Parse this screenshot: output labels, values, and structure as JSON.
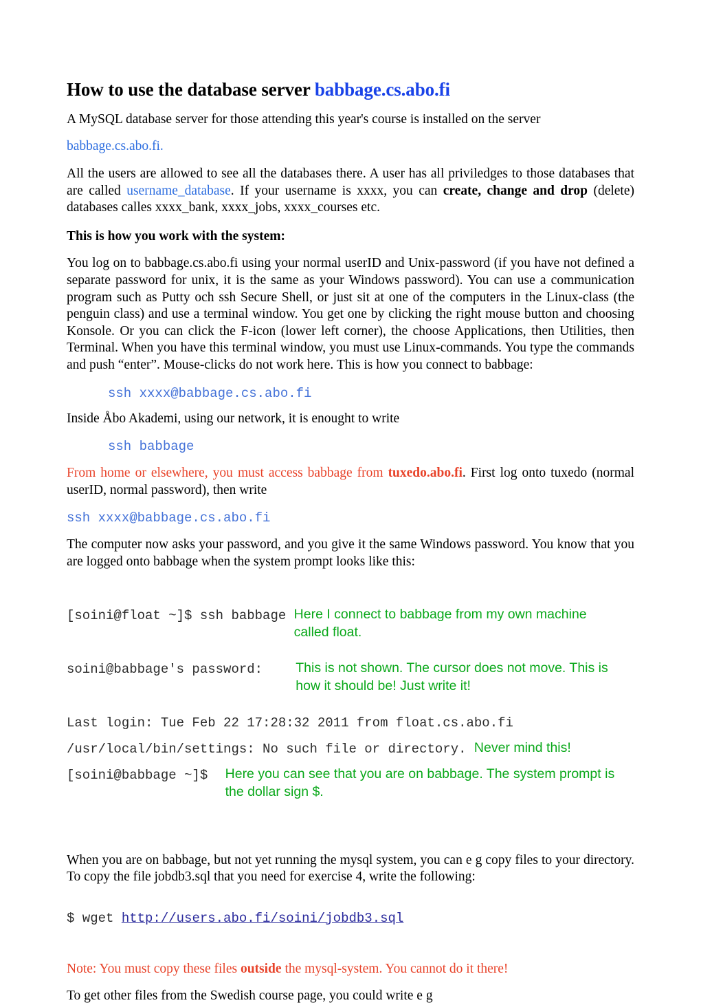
{
  "document": {
    "title_plain": "How to use the database server ",
    "title_host": "babbage.cs.abo.fi",
    "intro_line": "A MySQL database server for those attending this year's course is installed on the server",
    "intro_host": "babbage.cs.abo.fi.",
    "privileges_part1": "All the users are allowed to see all the databases there. A user has all priviledges to those databases that are called ",
    "privileges_link": "username_database",
    "privileges_part2": ". If your username is xxxx, you can ",
    "privileges_bold": "create, change and drop",
    "privileges_part3": " (delete) databases calles xxxx_bank, xxxx_jobs, xxxx_courses etc.",
    "howto_heading": "This is how you work with the system:",
    "logon_paragraph": "You log on to babbage.cs.abo.fi using your normal userID and Unix-password (if you have not defined a separate password for unix, it is the same as your Windows password). You can use a communication program such as Putty och ssh Secure Shell, or just sit at one of the computers in the Linux-class (the penguin class) and use a terminal window. You get one by clicking the right mouse button and choosing Konsole. Or you can click the F-icon (lower left corner), the choose Applications, then Utilities, then Terminal. When you have this terminal window, you must use Linux-commands. You type the commands and push “enter”. Mouse-clicks do not work here. This is how you connect to babbage:",
    "code_ssh_full": "ssh xxxx@babbage.cs.abo.fi",
    "inside_line": "Inside Åbo Akademi, using our network, it is enought to write",
    "code_ssh_short": "ssh babbage",
    "fromhome_part1": "From home or elsewhere, you must access babbage from ",
    "fromhome_bold": "tuxedo.abo.fi",
    "fromhome_part2": ". First log onto tuxedo (normal userID, normal password), then write",
    "code_ssh_full2": "ssh xxxx@babbage.cs.abo.fi",
    "password_paragraph": "The computer now asks your password, and you give it the same Windows password. You know that you are logged onto babbage when the system prompt looks like this:"
  },
  "terminal": {
    "line1_cmd": "[soini@float ~]$ ssh babbage ",
    "line1_note": "Here I connect to babbage from my own machine called float.",
    "line2_cmd": "soini@babbage's password:   ",
    "line2_note": "This is not shown. The cursor does not move. This is how it should be! Just write it!",
    "line3_cmd": "Last login: Tue Feb 22 17:28:32 2011 from float.cs.abo.fi",
    "line4_cmd": "/usr/local/bin/settings: No such file or directory. ",
    "line4_note": "Never mind this!",
    "line5_cmd": "[soini@babbage ~]$ ",
    "line5_note": "Here you can see that you are on babbage. The system prompt is the dollar sign $."
  },
  "footer": {
    "copy_paragraph": "When you are on babbage, but not yet running the mysql system, you can e g copy files to your directory. To copy the file jobdb3.sql that you need for exercise 4, write the following:",
    "wget_prefix": "$ wget ",
    "wget_url": "http://users.abo.fi/soini/jobdb3.sql",
    "note_part1": "Note: You must copy these files ",
    "note_bold": "outside",
    "note_part2": " the mysql-system. You cannot do it there!",
    "last_line": "To get other files from the Swedish course page, you could write e g"
  },
  "colors": {
    "title_blue": "#1a43e8",
    "link_blue": "#2f6fe0",
    "code_blue": "#4472d8",
    "red": "#e8432a",
    "green": "#0aa81a",
    "url_navy": "#2a2a9c",
    "body_black": "#000000"
  }
}
